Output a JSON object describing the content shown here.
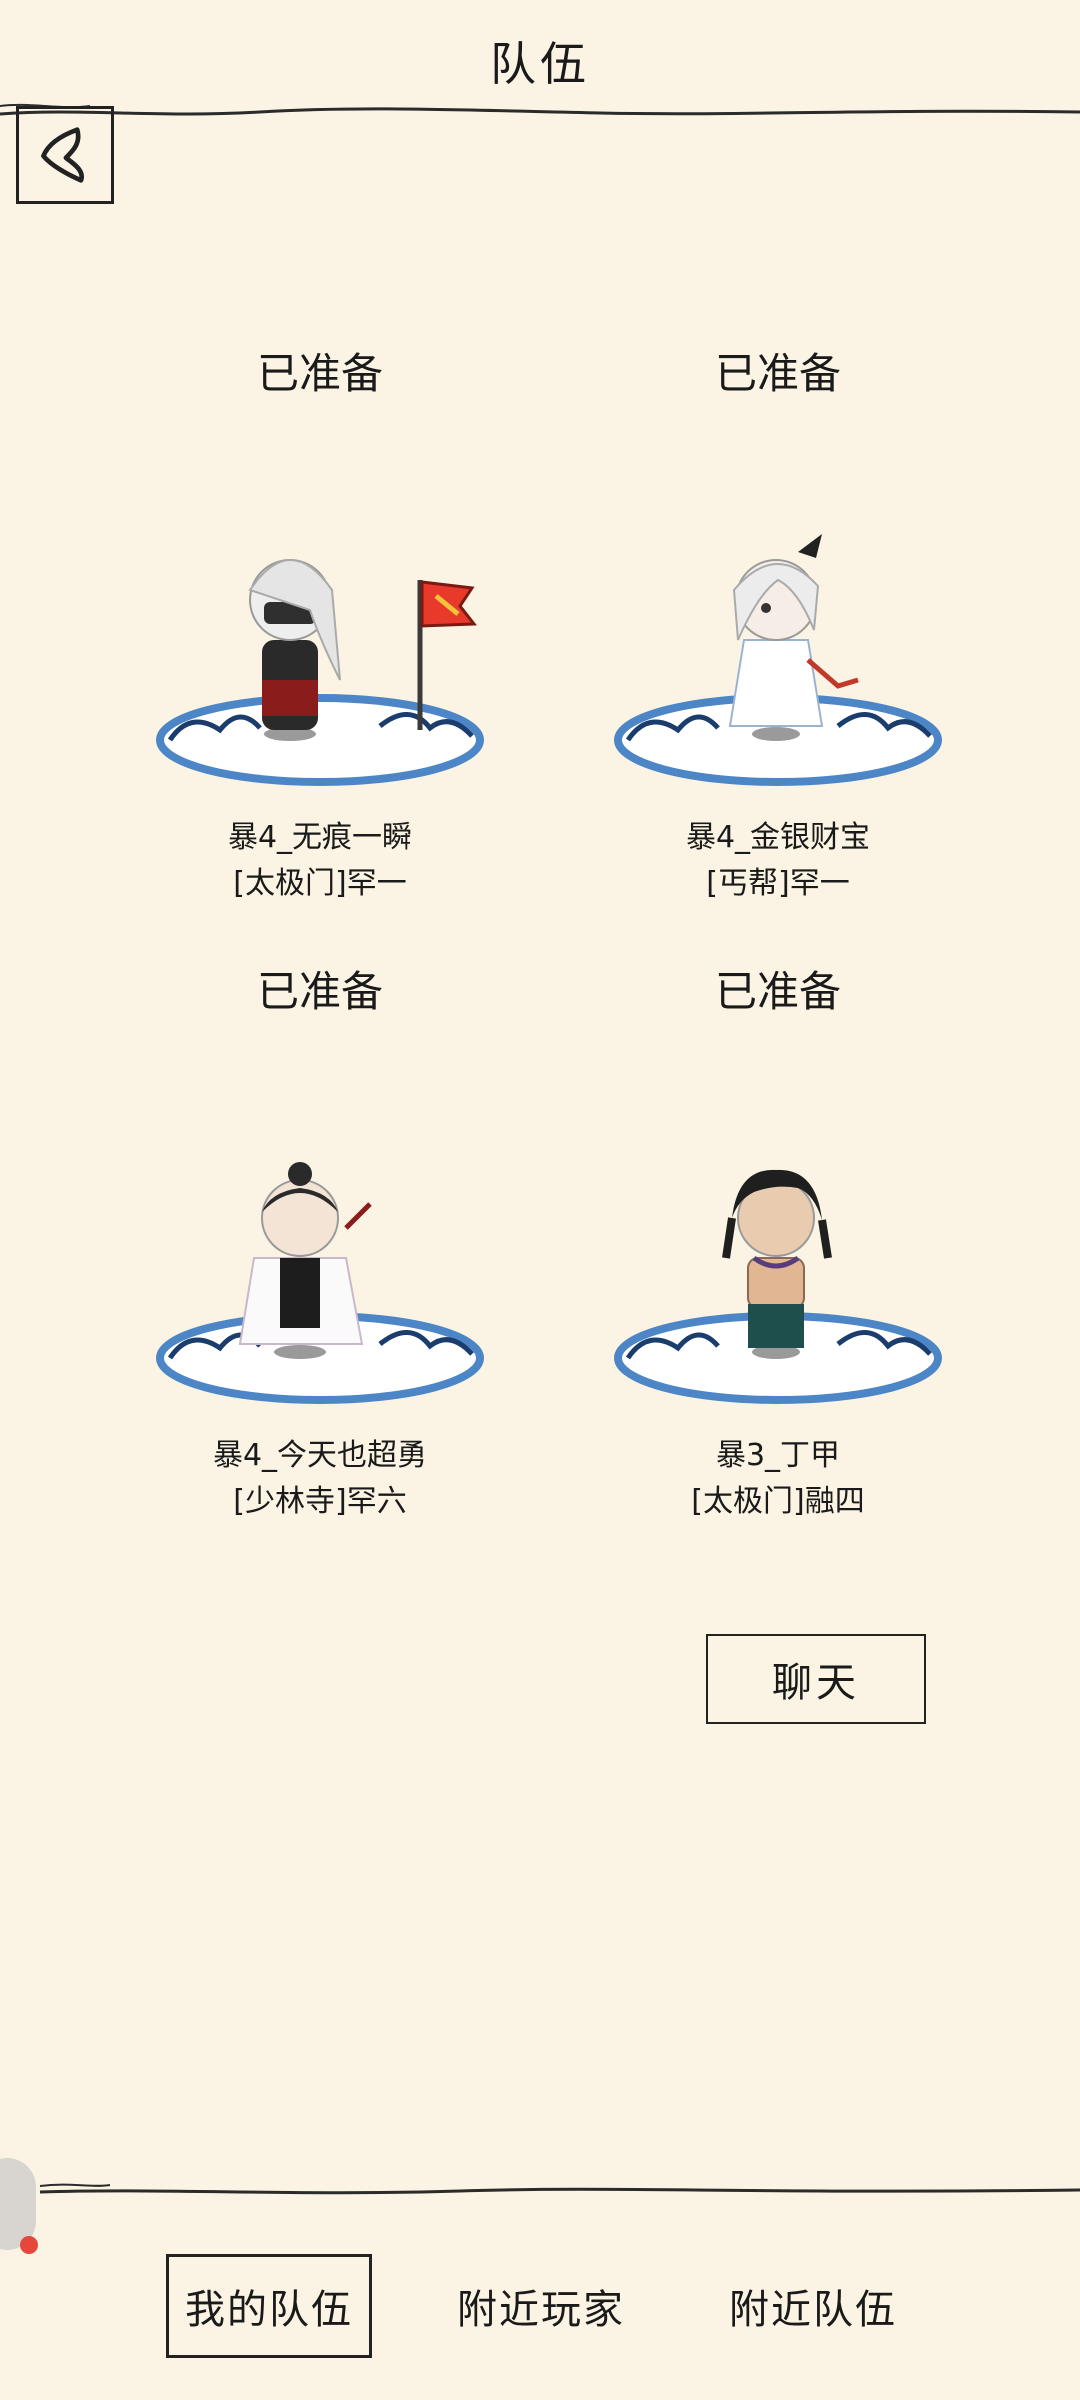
{
  "header": {
    "title": "队伍"
  },
  "members": [
    {
      "status": "已准备",
      "name": "暴4_无痕一瞬",
      "guild": "[太极门]罕一",
      "figure": "masked-swordsman-flag-icon"
    },
    {
      "status": "已准备",
      "name": "暴4_金银财宝",
      "guild": "[丐帮]罕一",
      "figure": "white-robed-girl-icon"
    },
    {
      "status": "已准备",
      "name": "暴4_今天也超勇",
      "guild": "[少林寺]罕六",
      "figure": "black-white-monk-icon"
    },
    {
      "status": "已准备",
      "name": "暴3_丁甲",
      "guild": "[太极门]融四",
      "figure": "bare-chested-fighter-icon"
    }
  ],
  "chat_button": {
    "label": "聊天"
  },
  "tabs": [
    {
      "label": "我的队伍",
      "active": true
    },
    {
      "label": "附近玩家",
      "active": false
    },
    {
      "label": "附近队伍",
      "active": false
    }
  ],
  "colors": {
    "background": "#fbf4e4",
    "ink": "#1a1a1a",
    "water": "#4d86c6",
    "notify": "#e5483a"
  }
}
